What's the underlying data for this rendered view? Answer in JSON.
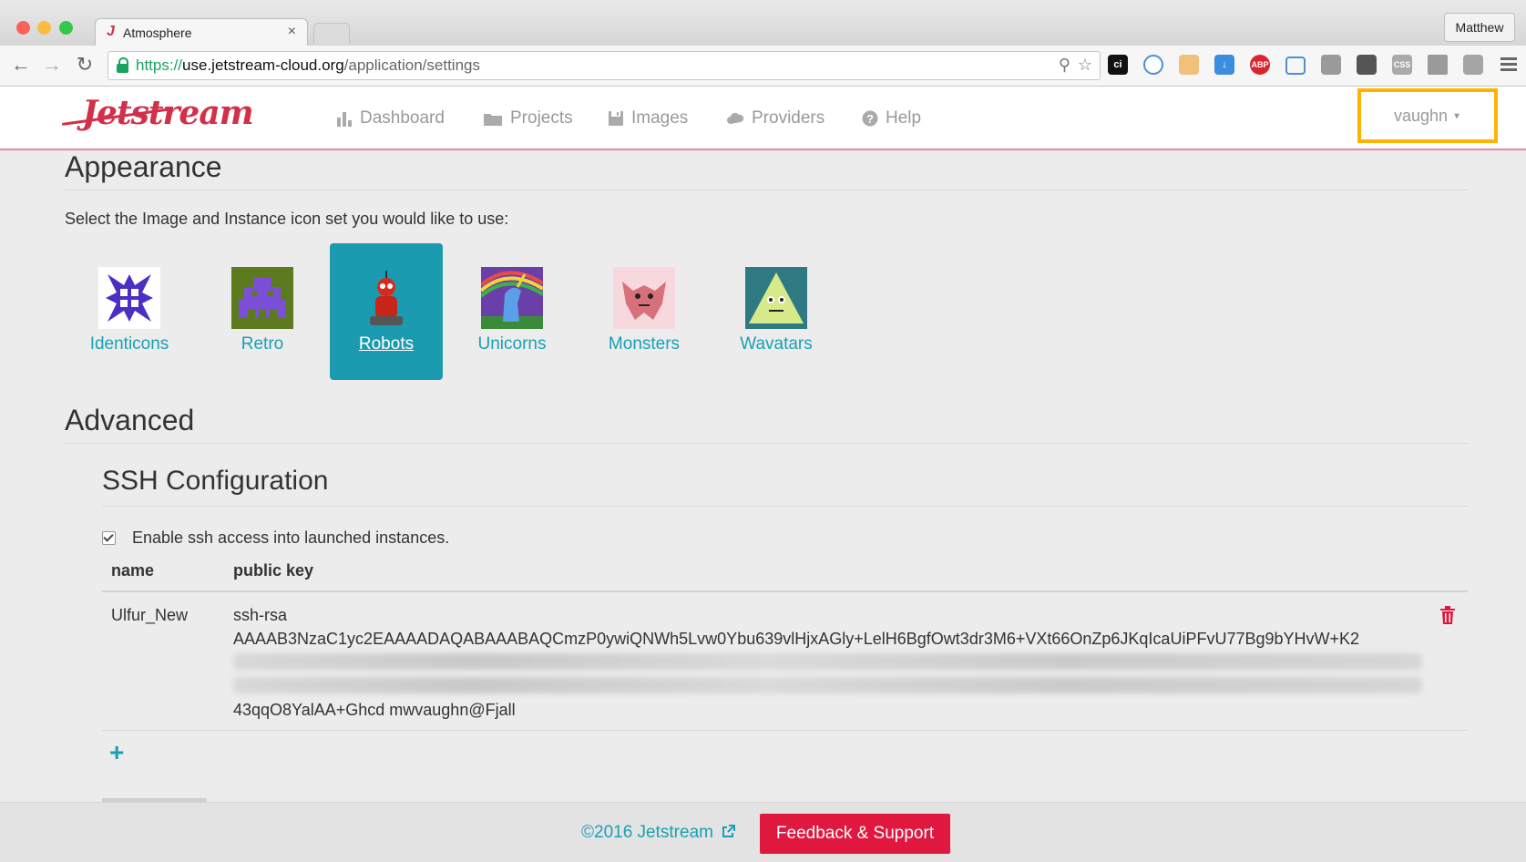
{
  "browser": {
    "tab_title": "Atmosphere",
    "tab_close": "×",
    "profile_name": "Matthew",
    "url_scheme": "https://",
    "url_host": "use.jetstream-cloud.org",
    "url_path": "/application/settings",
    "extensions": [
      "ci",
      "sync",
      "ghostery",
      "download",
      "ABP",
      "screenshot",
      "pages",
      "pocket",
      "css",
      "drive",
      "rss"
    ]
  },
  "nav": {
    "brand": "Jetstream",
    "items": [
      {
        "label": "Dashboard",
        "icon": "bar-chart-icon"
      },
      {
        "label": "Projects",
        "icon": "folder-icon"
      },
      {
        "label": "Images",
        "icon": "floppy-icon"
      },
      {
        "label": "Providers",
        "icon": "cloud-icon"
      },
      {
        "label": "Help",
        "icon": "question-circle-icon"
      }
    ],
    "user": "vaughn",
    "user_caret": "▼"
  },
  "appearance": {
    "title": "Appearance",
    "prompt": "Select the Image and Instance icon set you would like to use:",
    "icon_sets": [
      {
        "label": "Identicons",
        "selected": false
      },
      {
        "label": "Retro",
        "selected": false
      },
      {
        "label": "Robots",
        "selected": true
      },
      {
        "label": "Unicorns",
        "selected": false
      },
      {
        "label": "Monsters",
        "selected": false
      },
      {
        "label": "Wavatars",
        "selected": false
      }
    ]
  },
  "advanced": {
    "title": "Advanced",
    "ssh": {
      "title": "SSH Configuration",
      "enable_label": "Enable ssh access into launched instances.",
      "enabled": true,
      "columns": [
        "name",
        "public key"
      ],
      "keys": [
        {
          "name": "Ulfur_New",
          "key_line1": "ssh-rsa",
          "key_line2": "AAAAB3NzaC1yc2EAAAADAQABAAABAQCmzP0ywiQNWh5Lvw0Ybu639vlHjxAGly+LelH6BgfOwt3dr3M6+VXt66OnZp6JKqIcaUiPFvU77Bg9bYHvW+K2",
          "key_last": "43qqO8YalAA+Ghcd mwvaughn@Fjall"
        }
      ],
      "add_symbol": "+"
    }
  },
  "footer": {
    "copyright": "©2016 Jetstream",
    "feedback": "Feedback & Support"
  },
  "colors": {
    "accent": "#1aa0b4",
    "brand": "#d32f4a",
    "highlight": "#ffb300",
    "feedback_bg": "#e0183f"
  }
}
